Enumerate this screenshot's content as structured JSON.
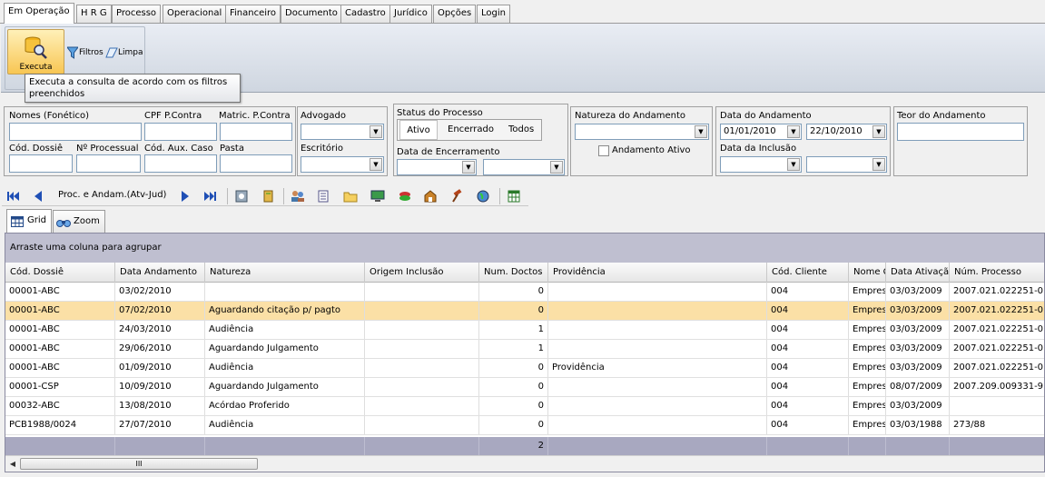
{
  "tabs": [
    "Em Operação",
    "H R G",
    "Processo",
    "Operacional",
    "Financeiro",
    "Documento",
    "Cadastro",
    "Jurídico",
    "Opções",
    "Login"
  ],
  "ribbon": {
    "execute_label": "Executa",
    "filters_label": "Filtros",
    "clear_label": "Limpa"
  },
  "tooltip": "Executa a consulta de acordo com os filtros preenchidos",
  "filters": {
    "nomes_label": "Nomes (Fonético)",
    "cpf_label": "CPF P.Contra",
    "matric_label": "Matric. P.Contra",
    "cod_dossie_label": "Cód. Dossiê",
    "num_processual_label": "Nº Processual",
    "cod_aux_label": "Cód. Aux. Caso",
    "pasta_label": "Pasta",
    "advogado_label": "Advogado",
    "escritorio_label": "Escritório",
    "status_label": "Status do Processo",
    "status_options": [
      "Ativo",
      "Encerrado",
      "Todos"
    ],
    "data_encerramento_label": "Data de Encerramento",
    "natureza_label": "Natureza do Andamento",
    "andamento_ativo_label": "Andamento Ativo",
    "data_andamento_label": "Data do Andamento",
    "data_andamento_from": "01/01/2010",
    "data_andamento_to": "22/10/2010",
    "data_inclusao_label": "Data da Inclusão",
    "teor_label": "Teor do Andamento"
  },
  "nav": {
    "title": "Proc. e Andam.(Atv-Jud)"
  },
  "views": {
    "grid_label": "Grid",
    "zoom_label": "Zoom"
  },
  "grid": {
    "group_hint": "Arraste uma coluna para agrupar",
    "columns": [
      "Cód. Dossiê",
      "Data Andamento",
      "Natureza",
      "Origem Inclusão",
      "Num. Doctos",
      "Providência",
      "Cód. Cliente",
      "Nome C",
      "Data Ativaçã",
      "Núm. Processo"
    ],
    "rows": [
      [
        "00001-ABC",
        "03/02/2010",
        "",
        "",
        "0",
        "",
        "004",
        "Empres",
        "03/03/2009",
        "2007.021.022251-0"
      ],
      [
        "00001-ABC",
        "07/02/2010",
        "Aguardando citação p/ pagto",
        "",
        "0",
        "",
        "004",
        "Empres",
        "03/03/2009",
        "2007.021.022251-0"
      ],
      [
        "00001-ABC",
        "24/03/2010",
        "Audiência",
        "",
        "1",
        "",
        "004",
        "Empres",
        "03/03/2009",
        "2007.021.022251-0"
      ],
      [
        "00001-ABC",
        "29/06/2010",
        "Aguardando Julgamento",
        "",
        "1",
        "",
        "004",
        "Empres",
        "03/03/2009",
        "2007.021.022251-0"
      ],
      [
        "00001-ABC",
        "01/09/2010",
        "Audiência",
        "",
        "0",
        "Providência",
        "004",
        "Empres",
        "03/03/2009",
        "2007.021.022251-0"
      ],
      [
        "00001-CSP",
        "10/09/2010",
        "Aguardando Julgamento",
        "",
        "0",
        "",
        "004",
        "Empres",
        "08/07/2009",
        "2007.209.009331-9"
      ],
      [
        "00032-ABC",
        "13/08/2010",
        "Acórdao Proferido",
        "",
        "0",
        "",
        "004",
        "Empres",
        "03/03/2009",
        ""
      ],
      [
        "PCB1988/0024",
        "27/07/2010",
        "Audiência",
        "",
        "0",
        "",
        "004",
        "Empres",
        "03/03/1988",
        "273/88"
      ]
    ],
    "selected_row": 1,
    "footer_total": "2",
    "scroll_grip": "III"
  },
  "colors": {
    "selected_row": "#fbe0a6",
    "group_area": "#bfbfd0",
    "footer": "#a8a8c0"
  }
}
